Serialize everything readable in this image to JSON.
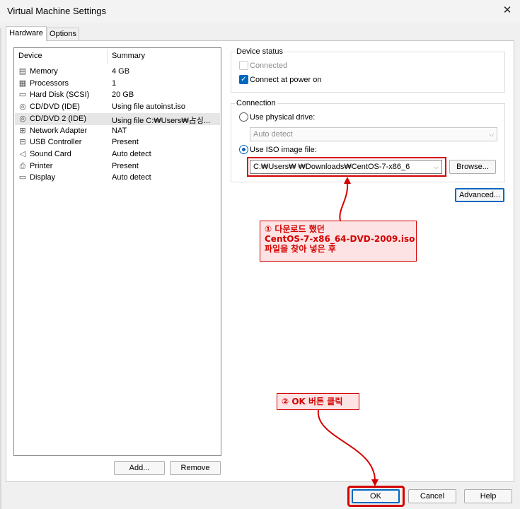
{
  "window": {
    "title": "Virtual Machine Settings",
    "close_glyph": "✕"
  },
  "tabs": [
    {
      "label": "Hardware"
    },
    {
      "label": "Options"
    }
  ],
  "device_list": {
    "columns": {
      "device": "Device",
      "summary": "Summary"
    },
    "rows": [
      {
        "icon": "memory-icon",
        "glyph": "▤",
        "name": "Memory",
        "summary": "4 GB"
      },
      {
        "icon": "processor-icon",
        "glyph": "▦",
        "name": "Processors",
        "summary": "1"
      },
      {
        "icon": "hard-disk-icon",
        "glyph": "▭",
        "name": "Hard Disk (SCSI)",
        "summary": "20 GB"
      },
      {
        "icon": "cd-dvd-icon",
        "glyph": "◎",
        "name": "CD/DVD (IDE)",
        "summary": "Using file autoinst.iso"
      },
      {
        "icon": "cd-dvd-icon",
        "glyph": "◎",
        "name": "CD/DVD 2 (IDE)",
        "summary": "Using file C:₩Users₩占싱..."
      },
      {
        "icon": "network-adapter-icon",
        "glyph": "⊞",
        "name": "Network Adapter",
        "summary": "NAT"
      },
      {
        "icon": "usb-icon",
        "glyph": "⊟",
        "name": "USB Controller",
        "summary": "Present"
      },
      {
        "icon": "speaker-icon",
        "glyph": "◁",
        "name": "Sound Card",
        "summary": "Auto detect"
      },
      {
        "icon": "printer-icon",
        "glyph": "⎙",
        "name": "Printer",
        "summary": "Present"
      },
      {
        "icon": "display-icon",
        "glyph": "▭",
        "name": "Display",
        "summary": "Auto detect"
      }
    ],
    "selected_index": 4
  },
  "buttons": {
    "add": "Add...",
    "remove": "Remove",
    "browse": "Browse...",
    "advanced": "Advanced...",
    "ok": "OK",
    "cancel": "Cancel",
    "help": "Help"
  },
  "device_status": {
    "label": "Device status",
    "connected": {
      "label": "Connected",
      "checked": false,
      "disabled": true
    },
    "connect_power_on": {
      "label": "Connect at power on",
      "checked": true
    }
  },
  "connection": {
    "label": "Connection",
    "physical": {
      "label": "Use physical drive:",
      "selected": false
    },
    "physical_value": "Auto detect",
    "iso": {
      "label": "Use ISO image file:",
      "selected": true
    },
    "iso_value": "C:₩Users₩        ₩Downloads₩CentOS-7-x86_6"
  },
  "annotations": {
    "step1": [
      "① 다운로드 했던",
      "CentOS-7-x86_64-DVD-2009.iso",
      "파일을 찾아 넣은 후"
    ],
    "step2": "② OK 버튼 클릭",
    "color": "#d40000"
  }
}
